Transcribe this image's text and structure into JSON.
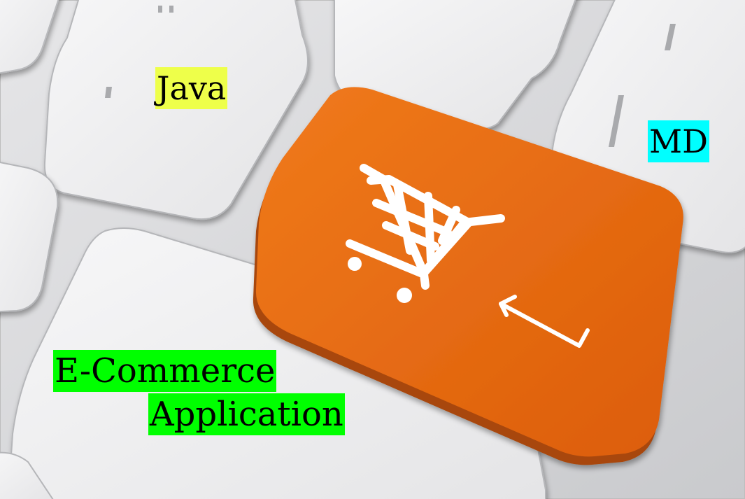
{
  "labels": {
    "java": "Java",
    "md": "MD",
    "ecommerce_line1": "E-Commerce",
    "ecommerce_line2": "Application"
  },
  "highlight_colors": {
    "java": "#eeff4a",
    "md": "#00ffff",
    "ecommerce": "#00ff00"
  },
  "key_colors": {
    "enter_key": "#e8670f",
    "white_key": "#f1f1f2",
    "keyboard_base": "#cfd0d3"
  },
  "icons": {
    "enter_key_symbol": "shopping-cart-icon",
    "enter_key_arrow": "return-arrow-icon"
  }
}
